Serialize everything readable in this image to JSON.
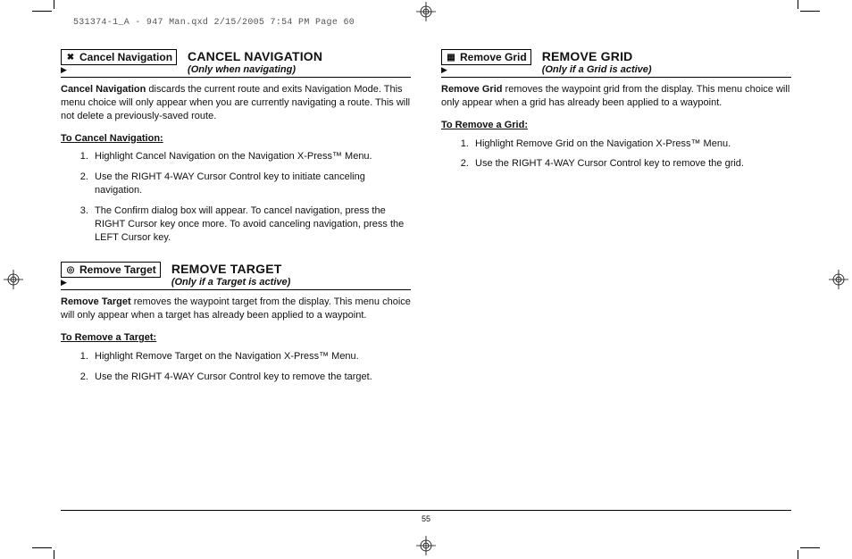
{
  "slug": "531374-1_A - 947 Man.qxd  2/15/2005  7:54 PM  Page 60",
  "page_number": "55",
  "left": {
    "cancel_nav": {
      "chip_label": "Cancel Navigation",
      "title": "CANCEL NAVIGATION",
      "subtitle": "(Only when navigating)",
      "lead": "Cancel Navigation",
      "body": " discards the current route and exits Navigation Mode. This menu choice will only appear when you are currently navigating a route. This will not delete a previously-saved route.",
      "proc_head": "To Cancel Navigation:",
      "steps": [
        "Highlight Cancel Navigation on the Navigation X-Press™ Menu.",
        "Use the RIGHT 4-WAY Cursor Control key to initiate canceling navigation.",
        "The Confirm dialog box will appear. To cancel navigation, press the RIGHT Cursor key once more. To avoid canceling navigation, press the LEFT Cursor key."
      ]
    },
    "remove_target": {
      "chip_label": "Remove Target",
      "title": "REMOVE TARGET",
      "subtitle": "(Only if a Target is active)",
      "lead": "Remove Target",
      "body": " removes the waypoint target from the display. This menu choice will only appear when a target has already been applied to a waypoint.",
      "proc_head": "To Remove a Target:",
      "steps": [
        "Highlight Remove Target on the Navigation X-Press™ Menu.",
        "Use the RIGHT 4-WAY Cursor Control key to remove the target."
      ]
    }
  },
  "right": {
    "remove_grid": {
      "chip_label": "Remove Grid",
      "title": "REMOVE GRID",
      "subtitle": "(Only if a Grid is active)",
      "lead": "Remove Grid",
      "body": " removes the waypoint grid from the display. This menu choice will only appear when a grid has already been applied to a waypoint.",
      "proc_head": "To Remove a Grid:",
      "steps": [
        "Highlight Remove Grid on the Navigation X-Press™ Menu.",
        "Use the RIGHT 4-WAY Cursor Control key to remove the grid."
      ]
    }
  }
}
